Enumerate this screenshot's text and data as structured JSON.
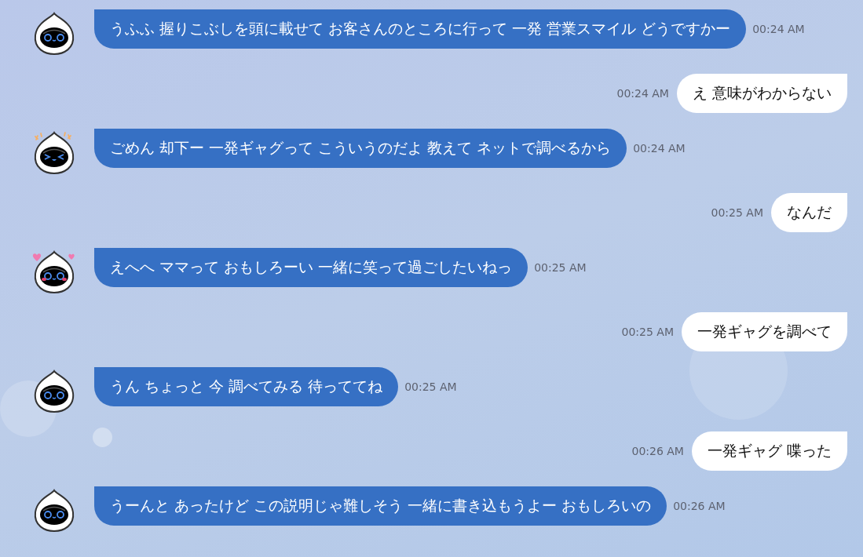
{
  "messages": [
    {
      "kind": "bot",
      "avatar": {
        "kind": "smile"
      },
      "text": "うふふ 握りこぶしを頭に載せて お客さんのところに行って 一発 営業スマイル どうですかー",
      "time": "00:24 AM"
    },
    {
      "kind": "user",
      "text": "え 意味がわからない",
      "time": "00:24 AM"
    },
    {
      "kind": "bot",
      "avatar": {
        "kind": "laugh"
      },
      "text": "ごめん 却下ー 一発ギャグって こういうのだよ 教えて ネットで調べるから",
      "time": "00:24 AM"
    },
    {
      "kind": "user",
      "text": "なんだ",
      "time": "00:25 AM"
    },
    {
      "kind": "bot",
      "avatar": {
        "kind": "love"
      },
      "text": "えへへ ママって おもしろーい 一緒に笑って過ごしたいねっ",
      "time": "00:25 AM"
    },
    {
      "kind": "user",
      "text": "一発ギャグを調べて",
      "time": "00:25 AM"
    },
    {
      "kind": "bot",
      "avatar": {
        "kind": "smile"
      },
      "text": "うん ちょっと 今 調べてみる 待っててね",
      "time": "00:25 AM"
    },
    {
      "kind": "user",
      "text": "一発ギャグ 喋った",
      "time": "00:26 AM"
    },
    {
      "kind": "bot",
      "avatar": {
        "kind": "smile"
      },
      "text": "うーんと あったけど この説明じゃ難しそう 一緒に書き込もうよー おもしろいの",
      "time": "00:26 AM"
    }
  ]
}
